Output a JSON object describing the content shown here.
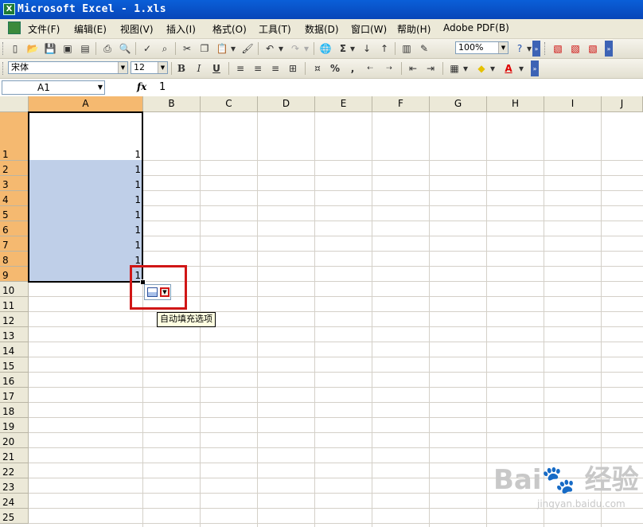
{
  "window": {
    "title": "Microsoft Excel - 1.xls"
  },
  "menu": [
    "文件(F)",
    "编辑(E)",
    "视图(V)",
    "插入(I)",
    "格式(O)",
    "工具(T)",
    "数据(D)",
    "窗口(W)",
    "帮助(H)",
    "Adobe PDF(B)"
  ],
  "toolbar": {
    "zoom": "100%",
    "font_name": "宋体",
    "font_size": "12",
    "bold": "B",
    "italic": "I",
    "underline": "U",
    "percent": "%",
    "comma": ","
  },
  "formula": {
    "cell_ref": "A1",
    "fx": "fx",
    "value": "1"
  },
  "columns": [
    "A",
    "B",
    "C",
    "D",
    "E",
    "F",
    "G",
    "H",
    "I",
    "J"
  ],
  "rows": [
    "1",
    "2",
    "3",
    "4",
    "5",
    "6",
    "7",
    "8",
    "9",
    "10",
    "11",
    "12",
    "13",
    "14",
    "15",
    "16",
    "17",
    "18",
    "19",
    "20",
    "21",
    "22",
    "23",
    "24",
    "25"
  ],
  "cells": {
    "A": [
      "1",
      "1",
      "1",
      "1",
      "1",
      "1",
      "1",
      "1",
      "1"
    ]
  },
  "autofill": {
    "tooltip": "自动填充选项"
  },
  "watermark": {
    "logo": "Bai du 经验",
    "url": "jingyan.baidu.com"
  },
  "colors": {
    "title_bar": "#0845b8",
    "selection": "#bfcfe8",
    "selected_header": "#f5b970",
    "highlight": "#d01616"
  }
}
